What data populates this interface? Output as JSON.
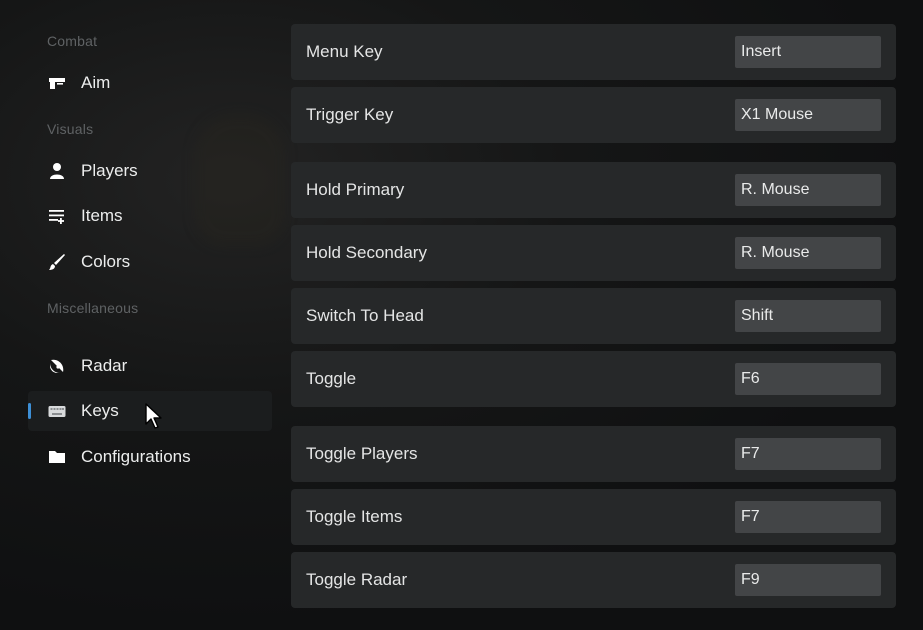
{
  "sidebar": {
    "sections": [
      {
        "label": "Combat",
        "items": [
          {
            "label": "Aim",
            "icon": "gun-icon"
          }
        ]
      },
      {
        "label": "Visuals",
        "items": [
          {
            "label": "Players",
            "icon": "person-icon"
          },
          {
            "label": "Items",
            "icon": "list-add-icon"
          },
          {
            "label": "Colors",
            "icon": "brush-icon"
          }
        ]
      },
      {
        "label": "Miscellaneous",
        "items": [
          {
            "label": "Radar",
            "icon": "radar-icon"
          },
          {
            "label": "Keys",
            "icon": "keyboard-icon",
            "active": true
          },
          {
            "label": "Configurations",
            "icon": "folder-icon"
          }
        ]
      }
    ]
  },
  "keybinds": [
    {
      "label": "Menu Key",
      "value": "Insert"
    },
    {
      "label": "Trigger Key",
      "value": "X1 Mouse"
    },
    {
      "label": "Hold Primary",
      "value": "R. Mouse"
    },
    {
      "label": "Hold Secondary",
      "value": "R. Mouse"
    },
    {
      "label": "Switch To Head",
      "value": "Shift"
    },
    {
      "label": "Toggle",
      "value": "F6"
    },
    {
      "label": "Toggle Players",
      "value": "F7"
    },
    {
      "label": "Toggle Items",
      "value": "F7"
    },
    {
      "label": "Toggle Radar",
      "value": "F9"
    }
  ],
  "colors": {
    "accent": "#3d8fd6",
    "row_bg": "#262829",
    "field_bg": "#434547",
    "section_label": "#5f6264"
  }
}
